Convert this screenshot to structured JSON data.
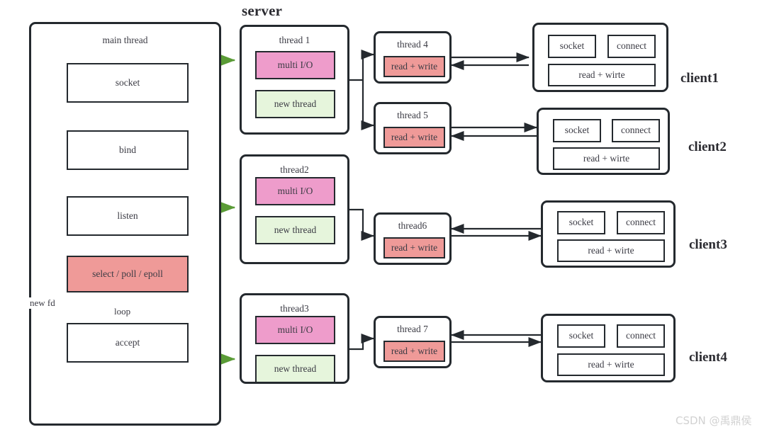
{
  "diagram": {
    "title_server": "server",
    "watermark": "CSDN @禹鼎侯"
  },
  "main_thread": {
    "label": "main  thread",
    "steps": [
      {
        "label": "socket"
      },
      {
        "label": "bind"
      },
      {
        "label": "listen"
      },
      {
        "label": "select / poll / epoll"
      },
      {
        "label": "accept"
      }
    ],
    "edge_labels": {
      "new_fd": "new fd",
      "loop": "loop"
    }
  },
  "server_threads": [
    {
      "label": "thread 1",
      "multi_io": "multi I/O",
      "new_thread": "new thread"
    },
    {
      "label": "thread2",
      "multi_io": "multi I/O",
      "new_thread": "new thread"
    },
    {
      "label": "thread3",
      "multi_io": "multi I/O",
      "new_thread": "new thread"
    }
  ],
  "worker_threads": [
    {
      "label": "thread 4",
      "work": "read + write"
    },
    {
      "label": "thread 5",
      "work": "read + write"
    },
    {
      "label": "thread6",
      "work": "read + write"
    },
    {
      "label": "thread 7",
      "work": "read + write"
    }
  ],
  "clients": [
    {
      "name": "client1",
      "socket": "socket",
      "connect": "connect",
      "readwrite": "read  + wirte"
    },
    {
      "name": "client2",
      "socket": "socket",
      "connect": "connect",
      "readwrite": "read  + wirte"
    },
    {
      "name": "client3",
      "socket": "socket",
      "connect": "connect",
      "readwrite": "read  + wirte"
    },
    {
      "name": "client4",
      "socket": "socket",
      "connect": "connect",
      "readwrite": "read  + wirte"
    }
  ],
  "colors": {
    "stroke": "#24292e",
    "green_arrow": "#5a9b36",
    "pink": "#ee9ccb",
    "light_green": "#e6f5dc",
    "salmon": "#ef9a98",
    "text": "#3b3b44",
    "watermark": "#d2d2d2"
  }
}
